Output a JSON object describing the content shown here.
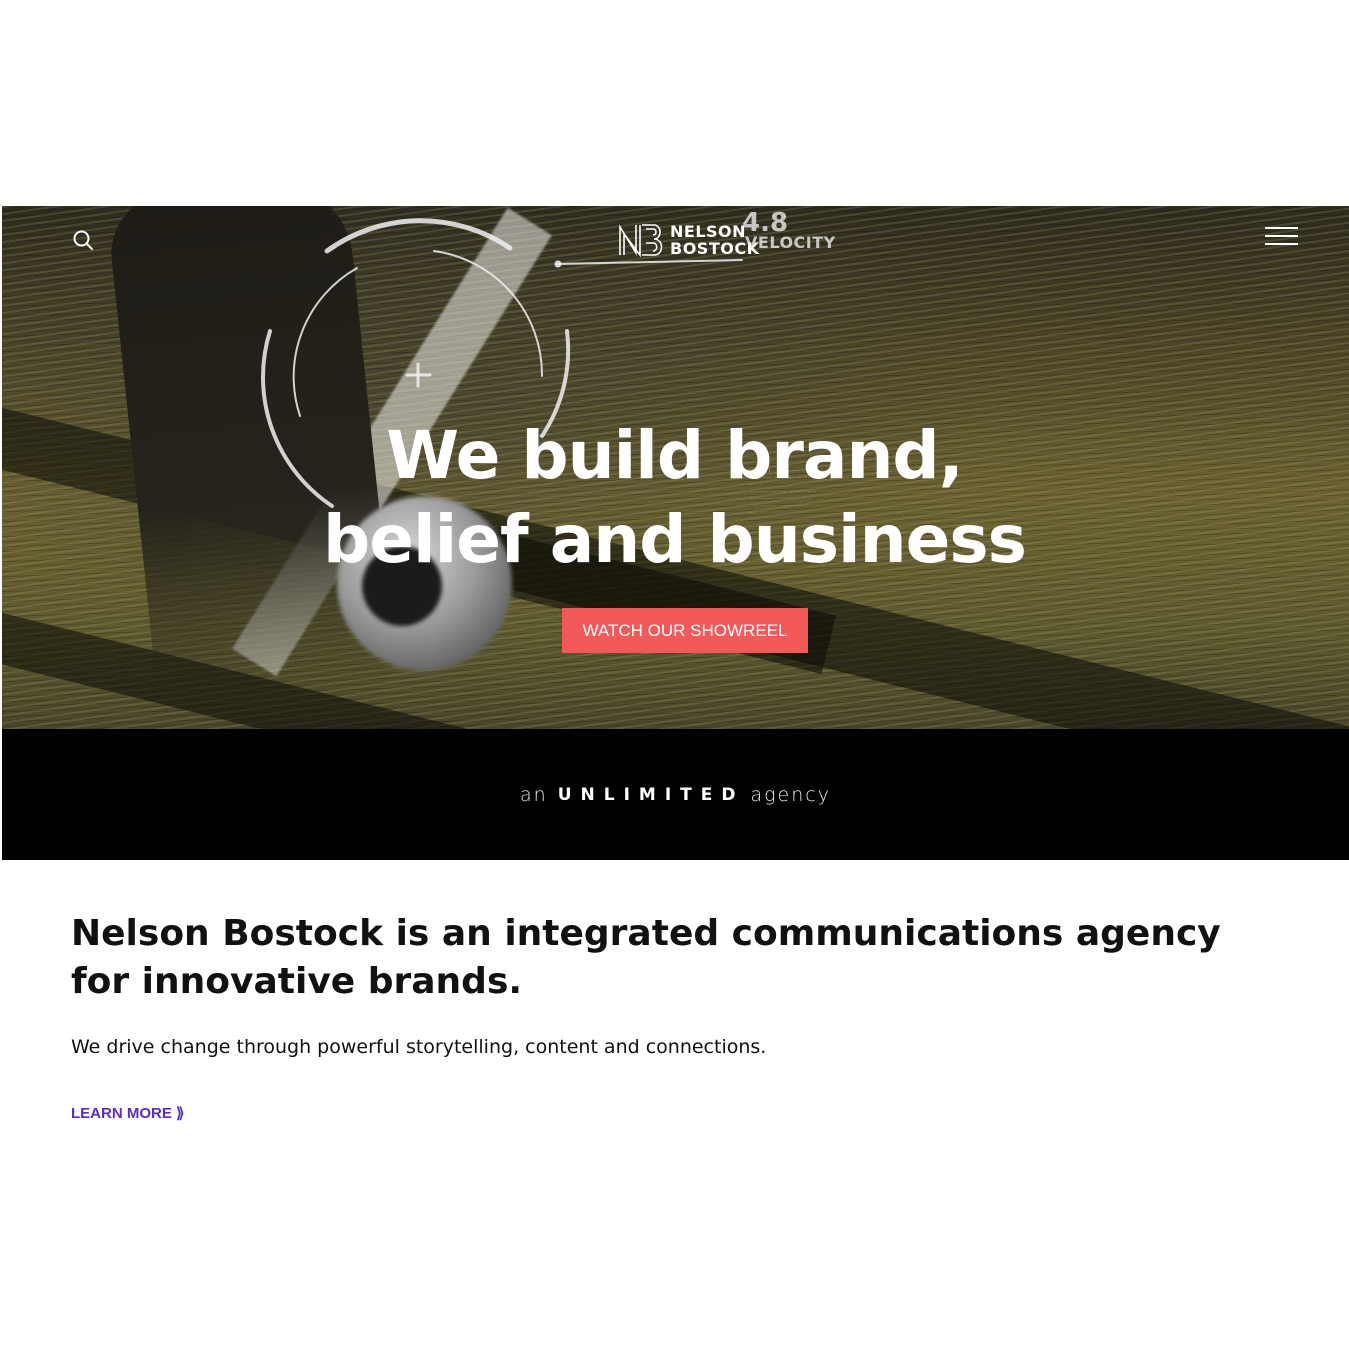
{
  "header": {
    "search_icon": "search-icon",
    "menu_icon": "hamburger-menu-icon",
    "logo": {
      "monogram": "NB",
      "line1": "NELSON",
      "line2": "BOSTOCK"
    },
    "hud_overlay": {
      "number": "4.8",
      "label": "VELOCITY"
    }
  },
  "hero": {
    "title_line1": "We build brand,",
    "title_line2": "belief and business",
    "cta_label": "WATCH OUR SHOWREEL",
    "cta_color": "#f25a5a"
  },
  "band": {
    "prefix": "an",
    "highlight": "UNLIMITED",
    "suffix": "agency"
  },
  "intro": {
    "heading": "Nelson Bostock is an integrated communications agency for innovative brands.",
    "text": "We drive change through powerful storytelling, content and connections.",
    "link_label": "LEARN MORE",
    "link_icon": "double-chevron-right-icon",
    "link_color": "#5b2bc4"
  }
}
